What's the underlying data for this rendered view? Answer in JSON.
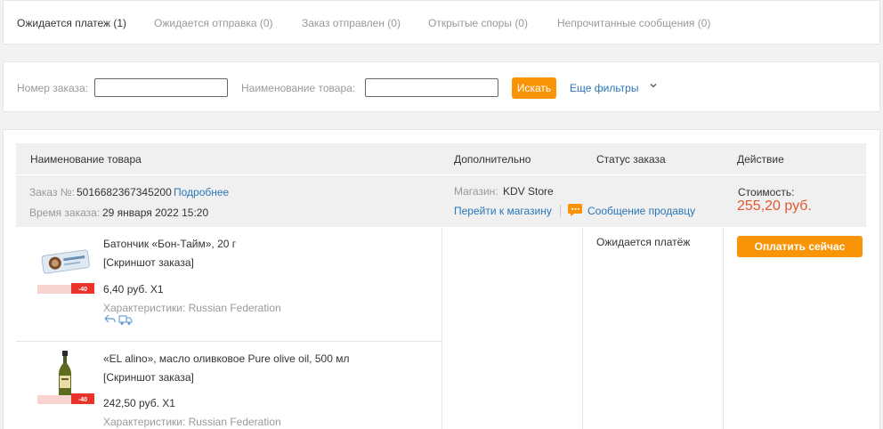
{
  "tabs": [
    {
      "label": "Ожидается платеж (1)"
    },
    {
      "label": "Ожидается отправка (0)"
    },
    {
      "label": "Заказ отправлен (0)"
    },
    {
      "label": "Открытые споры (0)"
    },
    {
      "label": "Непрочитанные сообщения (0)"
    }
  ],
  "filters": {
    "order_number_label": "Номер заказа:",
    "order_number_value": "",
    "product_name_label": "Наименование товара:",
    "product_name_value": "",
    "search_label": "Искать",
    "more_filters_label": "Еще фильтры"
  },
  "table": {
    "headers": [
      "Наименование товара",
      "Дополнительно",
      "Статус заказа",
      "Действие"
    ]
  },
  "order": {
    "number_label": "Заказ №:",
    "number": "5016682367345200",
    "details_link": "Подробнее",
    "time_label": "Время заказа:",
    "time": "29 января 2022 15:20",
    "store_label": "Магазин:",
    "store_name": "KDV Store",
    "goto_store_link": "Перейти к магазину",
    "message_seller_link": "Сообщение продавцу",
    "cost_label": "Стоимость:",
    "cost": "255,20 руб.",
    "status": "Ожидается платёж",
    "pay_button": "Оплатить сейчас",
    "items": [
      {
        "name": "Батончик «Бон-Тайм», 20 г",
        "screenshot": "[Скриншот заказа]",
        "price": "6,40 руб. X1",
        "characteristics": "Характеристики: Russian Federation",
        "badge": "-40"
      },
      {
        "name": "«EL alino», масло оливковое Pure olive oil, 500 мл",
        "screenshot": "[Скриншот заказа]",
        "price": "242,50 руб. X1",
        "characteristics": "Характеристики: Russian Federation",
        "badge": "-40"
      }
    ]
  },
  "colors": {
    "accent": "#f89406",
    "link": "#2a76b8",
    "price": "#e4572e"
  }
}
